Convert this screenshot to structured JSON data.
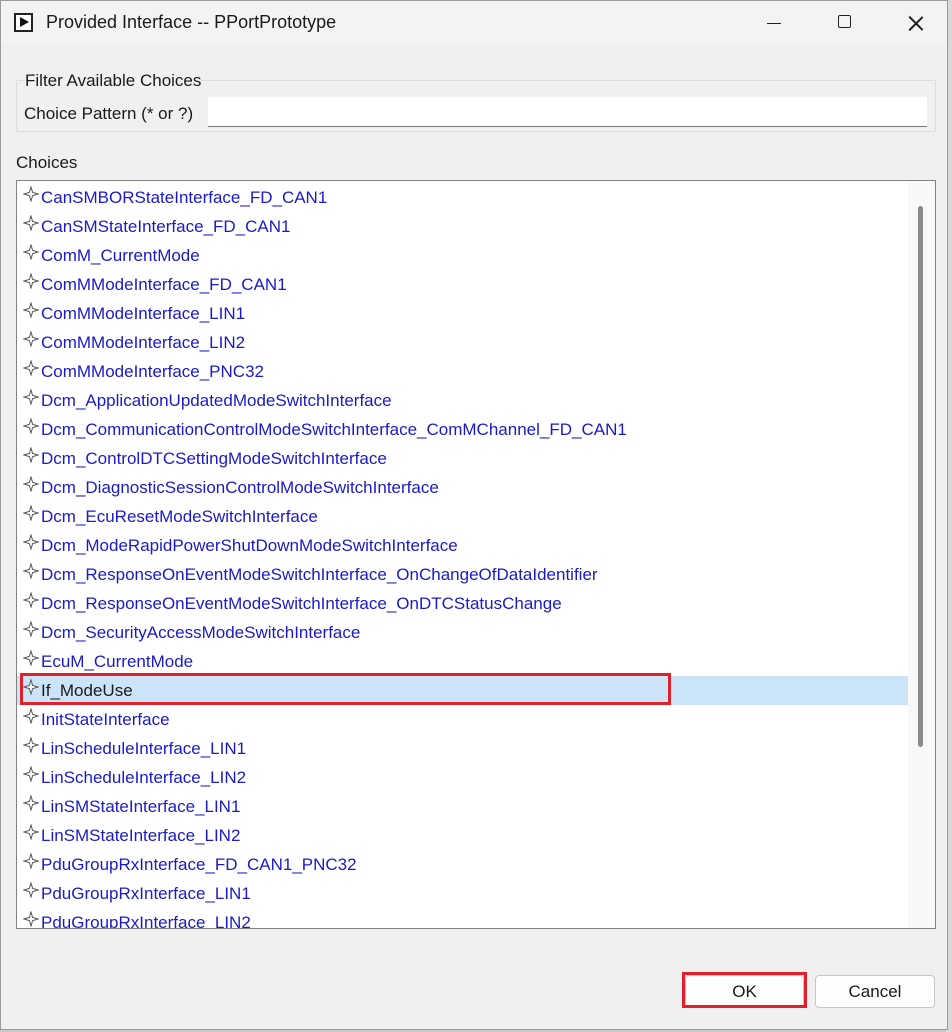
{
  "window": {
    "title": "Provided Interface -- PPortPrototype"
  },
  "filter": {
    "group_label": "Filter Available Choices",
    "pattern_label": "Choice Pattern (* or ?)",
    "pattern_value": ""
  },
  "choices": {
    "label": "Choices",
    "selected": "If_ModeUse",
    "items": [
      "CanSMBORStateInterface_FD_CAN1",
      "CanSMStateInterface_FD_CAN1",
      "ComM_CurrentMode",
      "ComMModeInterface_FD_CAN1",
      "ComMModeInterface_LIN1",
      "ComMModeInterface_LIN2",
      "ComMModeInterface_PNC32",
      "Dcm_ApplicationUpdatedModeSwitchInterface",
      "Dcm_CommunicationControlModeSwitchInterface_ComMChannel_FD_CAN1",
      "Dcm_ControlDTCSettingModeSwitchInterface",
      "Dcm_DiagnosticSessionControlModeSwitchInterface",
      "Dcm_EcuResetModeSwitchInterface",
      "Dcm_ModeRapidPowerShutDownModeSwitchInterface",
      "Dcm_ResponseOnEventModeSwitchInterface_OnChangeOfDataIdentifier",
      "Dcm_ResponseOnEventModeSwitchInterface_OnDTCStatusChange",
      "Dcm_SecurityAccessModeSwitchInterface",
      "EcuM_CurrentMode",
      "If_ModeUse",
      "InitStateInterface",
      "LinScheduleInterface_LIN1",
      "LinScheduleInterface_LIN2",
      "LinSMStateInterface_LIN1",
      "LinSMStateInterface_LIN2",
      "PduGroupRxInterface_FD_CAN1_PNC32",
      "PduGroupRxInterface_LIN1",
      "PduGroupRxInterface_LIN2"
    ],
    "item_icon": "mode-interface-icon"
  },
  "buttons": {
    "ok": "OK",
    "cancel": "Cancel"
  },
  "colors": {
    "item_text": "#1a1acc",
    "selection_bg": "#cce4f7",
    "highlight_border": "#e0202a"
  }
}
